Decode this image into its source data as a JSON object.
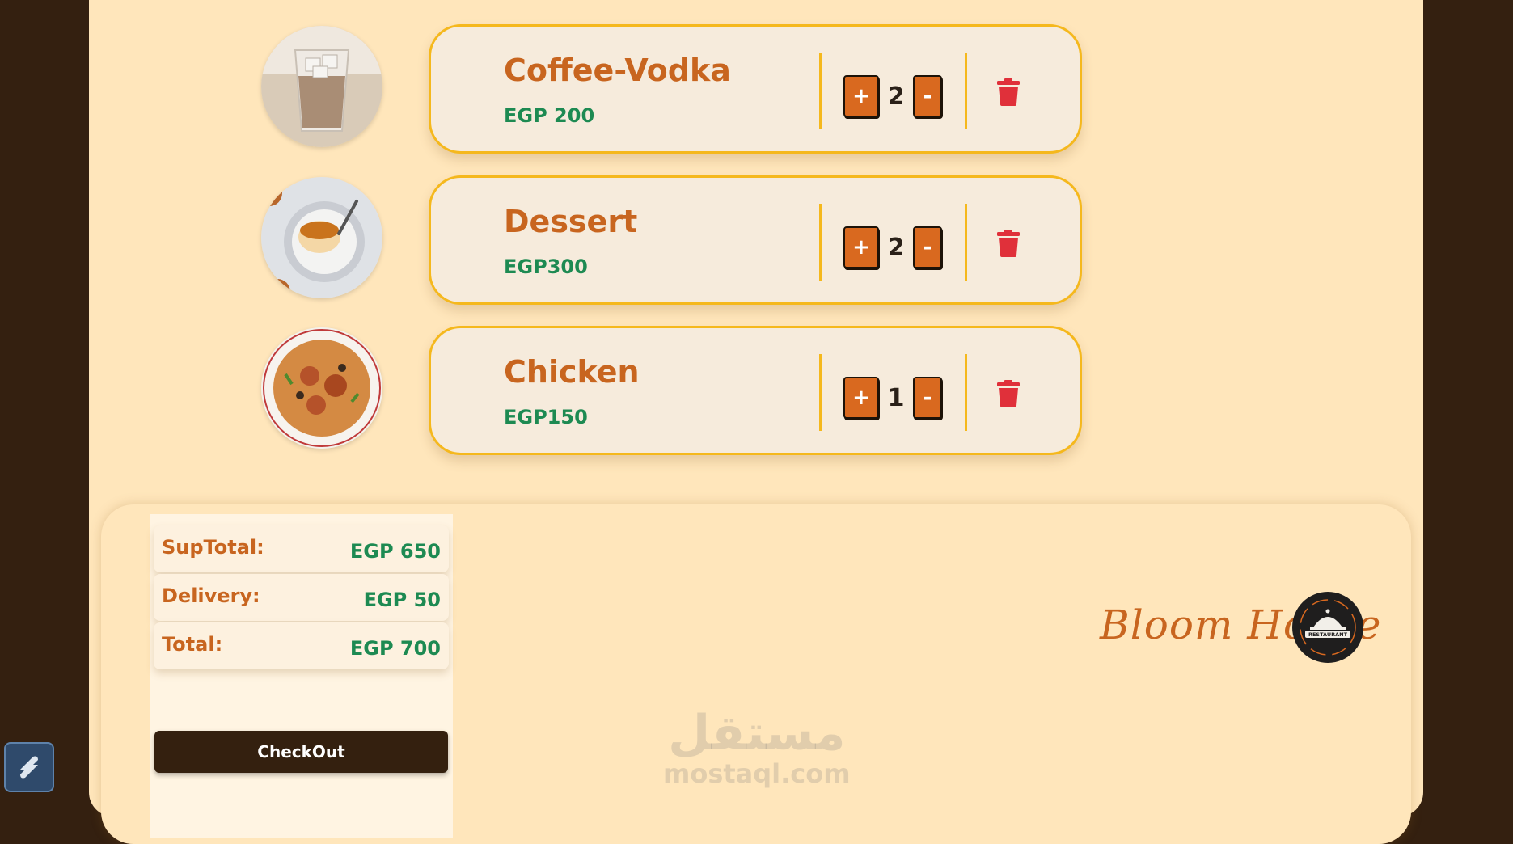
{
  "cart": {
    "items": [
      {
        "name": "Coffee-Vodka",
        "price": "EGP 200",
        "qty": "2",
        "image": "iced-coffee-glass"
      },
      {
        "name": "Dessert",
        "price": "EGP300",
        "qty": "2",
        "image": "caramel-pudding"
      },
      {
        "name": "Chicken",
        "price": "EGP150",
        "qty": "1",
        "image": "chicken-rice-plate"
      }
    ],
    "plus_label": "+",
    "minus_label": "-",
    "delete_icon": "trash-icon"
  },
  "summary": {
    "subtotal_label": "SupTotal:",
    "subtotal_value": "EGP 650",
    "delivery_label": "Delivery:",
    "delivery_value": "EGP 50",
    "total_label": "Total:",
    "total_value": "EGP 700",
    "checkout_label": "CheckOut"
  },
  "brand": {
    "name": "Bloom House",
    "logo_text": "RESTAURANT"
  },
  "watermark": {
    "arabic": "مستقل",
    "latin": "mostaql.com"
  },
  "colors": {
    "background": "#342010",
    "panel": "#ffe6bb",
    "card": "#f6ebdc",
    "card_border": "#f5b81d",
    "accent": "#c8651f",
    "price": "#1d8a52",
    "button": "#d9691f",
    "delete": "#e0303a",
    "checkout": "#34200f"
  }
}
